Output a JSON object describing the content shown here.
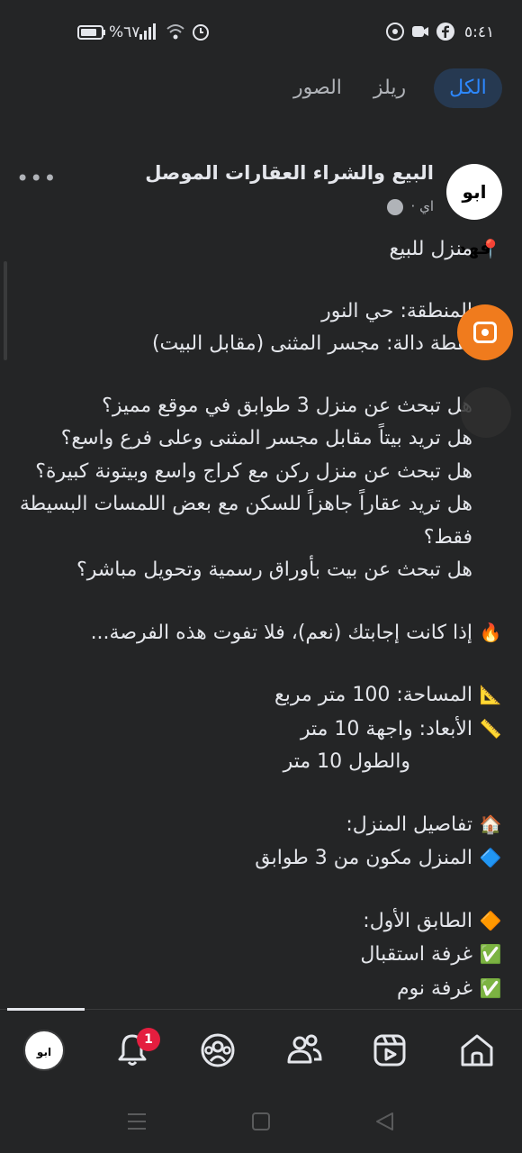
{
  "status_bar": {
    "time": "٥:٤١",
    "battery": "%٦٧"
  },
  "tabs": [
    {
      "label": "الكل",
      "active": true
    },
    {
      "label": "ريلز",
      "active": false
    },
    {
      "label": "الصور",
      "active": false
    }
  ],
  "post": {
    "avatar_text": "ابو فهد",
    "group_title": "البيع والشراء العقارات الموصل",
    "meta": "اي ·",
    "more_label": "•••",
    "lines": [
      {
        "emoji": "📍",
        "text": "منزل للبيع"
      },
      {
        "gap": true
      },
      {
        "emoji": "",
        "text": "المنطقة: حي النور"
      },
      {
        "emoji": "",
        "text": "نقطة دالة: مجسر المثنى (مقابل البيت)"
      },
      {
        "gap": true
      },
      {
        "emoji": "",
        "text": "هل تبحث عن منزل 3 طوابق في موقع مميز؟"
      },
      {
        "emoji": "",
        "text": "هل تريد بيتاً مقابل مجسر المثنى وعلى فرع واسع؟"
      },
      {
        "emoji": "",
        "text": "هل تبحث عن منزل ركن مع كراج واسع وبيتونة كبيرة؟"
      },
      {
        "emoji": "",
        "text": "هل تريد عقاراً جاهزاً للسكن مع بعض اللمسات البسيطة"
      },
      {
        "emoji": "",
        "text": "فقط؟"
      },
      {
        "emoji": "",
        "text": "هل تبحث عن بيت بأوراق رسمية وتحويل مباشر؟"
      },
      {
        "gap": true
      },
      {
        "emoji": "🔥",
        "text": "إذا كانت إجابتك (نعم)، فلا تفوت هذه الفرصة..."
      },
      {
        "gap": true
      },
      {
        "emoji": "📐",
        "text": "المساحة: 100 متر مربع"
      },
      {
        "emoji": "📏",
        "text": "الأبعاد: واجهة 10 متر"
      },
      {
        "emoji": "",
        "text": "والطول 10 متر",
        "indent": true
      },
      {
        "gap": true
      },
      {
        "emoji": "🏠",
        "text": "تفاصيل المنزل:"
      },
      {
        "emoji": "🔷",
        "text": "المنزل مكون من 3 طوابق"
      },
      {
        "gap": true
      },
      {
        "emoji": "🔶",
        "text": "الطابق الأول:"
      },
      {
        "emoji": "✅",
        "text": "غرفة استقبال"
      },
      {
        "emoji": "✅",
        "text": "غرفة نوم"
      }
    ]
  },
  "bottom_nav": {
    "avatar_text": "ابو فهد",
    "notification_count": "1",
    "items": [
      "profile",
      "notifications",
      "groups",
      "friends",
      "reels",
      "home"
    ]
  },
  "colors": {
    "background": "#242526",
    "text": "#e4e6eb",
    "accent": "#2d88ff",
    "badge": "#e41e3f",
    "float_button": "#f07b1d"
  }
}
